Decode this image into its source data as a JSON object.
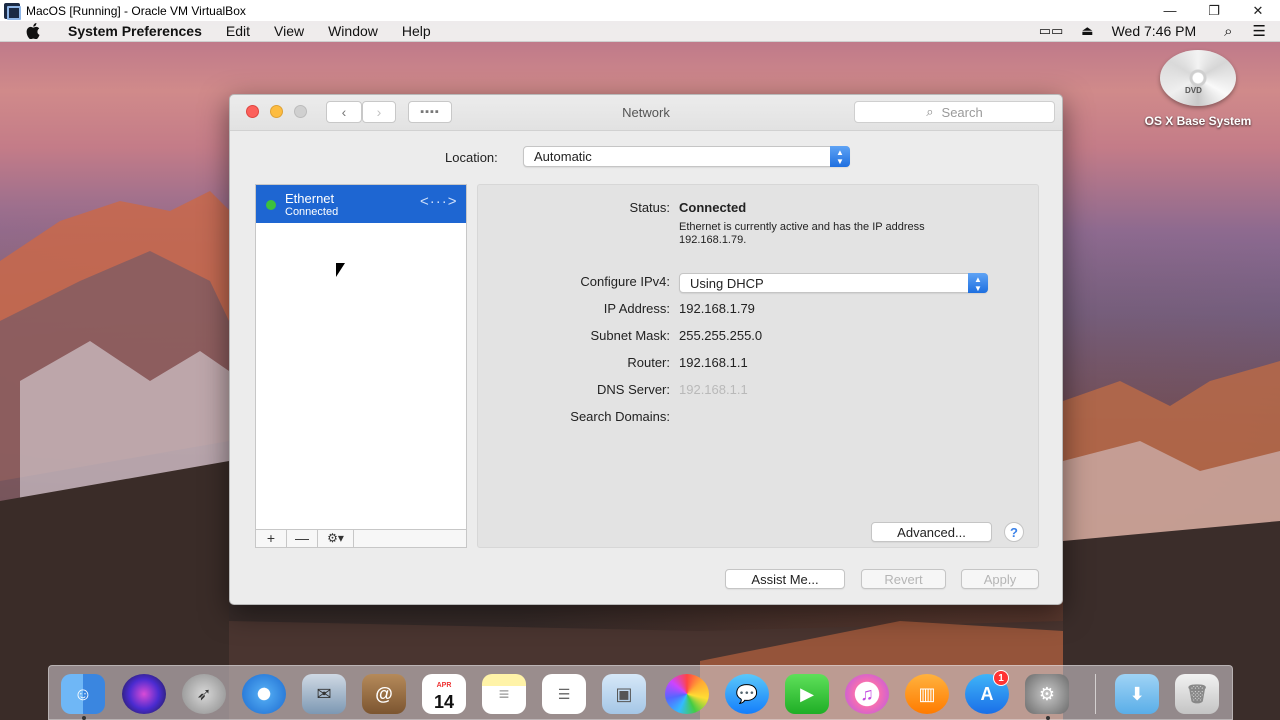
{
  "host": {
    "title": "MacOS [Running] - Oracle VM VirtualBox",
    "minimize": "—",
    "restore": "❐",
    "close": "✕"
  },
  "menubar": {
    "apple": "",
    "app": "System Preferences",
    "items": [
      "Edit",
      "View",
      "Window",
      "Help"
    ],
    "clock": "Wed 7:46 PM"
  },
  "desktop": {
    "disk_tag": "DVD",
    "disk_label": "OS X Base System"
  },
  "window": {
    "title": "Network",
    "search_placeholder": "Search",
    "location_label": "Location:",
    "location_value": "Automatic"
  },
  "services": [
    {
      "name": "Ethernet",
      "status": "Connected"
    }
  ],
  "list_bar": {
    "add": "+",
    "remove": "—",
    "gear": "⚙▾"
  },
  "details": {
    "status_label": "Status:",
    "status_value": "Connected",
    "status_desc": "Ethernet is currently active and has the IP address 192.168.1.79.",
    "configure_label": "Configure IPv4:",
    "configure_value": "Using DHCP",
    "ip_label": "IP Address:",
    "ip_value": "192.168.1.79",
    "subnet_label": "Subnet Mask:",
    "subnet_value": "255.255.255.0",
    "router_label": "Router:",
    "router_value": "192.168.1.1",
    "dns_label": "DNS Server:",
    "dns_value": "192.168.1.1",
    "search_domains_label": "Search Domains:",
    "advanced": "Advanced...",
    "help": "?"
  },
  "footer": {
    "assist": "Assist Me...",
    "revert": "Revert",
    "apply": "Apply"
  },
  "dock": {
    "calendar_month": "APR",
    "calendar_day": "14",
    "appstore_badge": "1"
  },
  "colors": {
    "selection_blue": "#1e66d2",
    "status_green": "#3cc13c",
    "close_red": "#fc605b",
    "minimize_yellow": "#fdbc40"
  }
}
